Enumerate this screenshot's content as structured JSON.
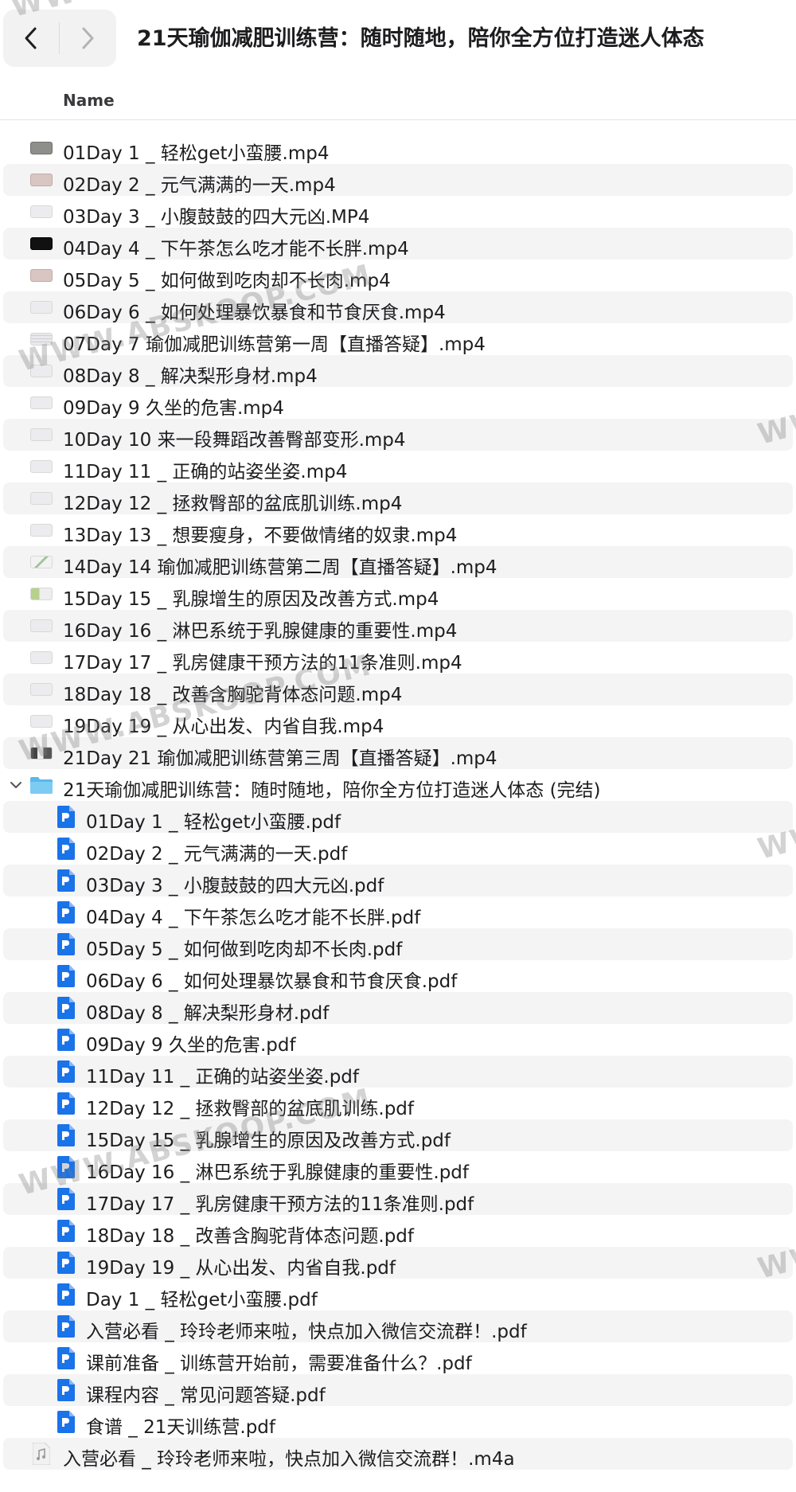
{
  "toolbar": {
    "title": "21天瑜伽减肥训练营：随时随地，陪你全方位打造迷人体态"
  },
  "columns": {
    "name_header": "Name"
  },
  "files": [
    {
      "name": "01Day 1 _ 轻松get小蛮腰.mp4",
      "level": 0,
      "icon": "video-thumbnail-icon",
      "thumb": "gray"
    },
    {
      "name": "02Day 2 _ 元气满满的一天.mp4",
      "level": 0,
      "icon": "video-thumbnail-icon",
      "thumb": "pink"
    },
    {
      "name": "03Day 3 _ 小腹鼓鼓的四大元凶.MP4",
      "level": 0,
      "icon": "video-thumbnail-icon",
      "thumb": "plain"
    },
    {
      "name": "04Day 4 _ 下午茶怎么吃才能不长胖.mp4",
      "level": 0,
      "icon": "video-thumbnail-icon",
      "thumb": "black"
    },
    {
      "name": "05Day 5 _ 如何做到吃肉却不长肉.mp4",
      "level": 0,
      "icon": "video-thumbnail-icon",
      "thumb": "pink"
    },
    {
      "name": "06Day 6 _ 如何处理暴饮暴食和节食厌食.mp4",
      "level": 0,
      "icon": "video-thumbnail-icon",
      "thumb": "plain"
    },
    {
      "name": "07Day 7  瑜伽减肥训练营第一周【直播答疑】.mp4",
      "level": 0,
      "icon": "video-thumbnail-icon",
      "thumb": "grid"
    },
    {
      "name": "08Day 8 _ 解决梨形身材.mp4",
      "level": 0,
      "icon": "video-thumbnail-icon",
      "thumb": "plain"
    },
    {
      "name": "09Day 9 久坐的危害.mp4",
      "level": 0,
      "icon": "video-thumbnail-icon",
      "thumb": "plain"
    },
    {
      "name": "10Day 10 来一段舞蹈改善臀部变形.mp4",
      "level": 0,
      "icon": "video-thumbnail-icon",
      "thumb": "plain"
    },
    {
      "name": "11Day 11 _ 正确的站姿坐姿.mp4",
      "level": 0,
      "icon": "video-thumbnail-icon",
      "thumb": "plain"
    },
    {
      "name": "12Day 12 _ 拯救臀部的盆底肌训练.mp4",
      "level": 0,
      "icon": "video-thumbnail-icon",
      "thumb": "plain"
    },
    {
      "name": "13Day 13 _ 想要瘦身，不要做情绪的奴隶.mp4",
      "level": 0,
      "icon": "video-thumbnail-icon",
      "thumb": "plain"
    },
    {
      "name": "14Day 14  瑜伽减肥训练营第二周【直播答疑】.mp4",
      "level": 0,
      "icon": "video-thumbnail-icon",
      "thumb": "mail"
    },
    {
      "name": "15Day 15 _ 乳腺增生的原因及改善方式.mp4",
      "level": 0,
      "icon": "video-thumbnail-icon",
      "thumb": "green"
    },
    {
      "name": "16Day 16 _ 淋巴系统于乳腺健康的重要性.mp4",
      "level": 0,
      "icon": "video-thumbnail-icon",
      "thumb": "plain"
    },
    {
      "name": "17Day 17 _ 乳房健康干预方法的11条准则.mp4",
      "level": 0,
      "icon": "video-thumbnail-icon",
      "thumb": "plain"
    },
    {
      "name": "18Day 18 _ 改善含胸驼背体态问题.mp4",
      "level": 0,
      "icon": "video-thumbnail-icon",
      "thumb": "plain"
    },
    {
      "name": "19Day 19 _ 从心出发、内省自我.mp4",
      "level": 0,
      "icon": "video-thumbnail-icon",
      "thumb": "plain"
    },
    {
      "name": "21Day 21  瑜伽减肥训练营第三周【直播答疑】.mp4",
      "level": 0,
      "icon": "video-thumbnail-icon",
      "thumb": "dark"
    },
    {
      "name": "21天瑜伽减肥训练营：随时随地，陪你全方位打造迷人体态 (完结)",
      "level": 0,
      "icon": "folder-icon",
      "folder": true
    },
    {
      "name": "01Day 1 _ 轻松get小蛮腰.pdf",
      "level": 1,
      "icon": "pdf-file-icon"
    },
    {
      "name": "02Day 2 _ 元气满满的一天.pdf",
      "level": 1,
      "icon": "pdf-file-icon"
    },
    {
      "name": "03Day 3 _ 小腹鼓鼓的四大元凶.pdf",
      "level": 1,
      "icon": "pdf-file-icon"
    },
    {
      "name": "04Day 4 _ 下午茶怎么吃才能不长胖.pdf",
      "level": 1,
      "icon": "pdf-file-icon"
    },
    {
      "name": "05Day 5 _ 如何做到吃肉却不长肉.pdf",
      "level": 1,
      "icon": "pdf-file-icon"
    },
    {
      "name": "06Day 6 _ 如何处理暴饮暴食和节食厌食.pdf",
      "level": 1,
      "icon": "pdf-file-icon"
    },
    {
      "name": "08Day 8 _ 解决梨形身材.pdf",
      "level": 1,
      "icon": "pdf-file-icon"
    },
    {
      "name": "09Day 9 久坐的危害.pdf",
      "level": 1,
      "icon": "pdf-file-icon"
    },
    {
      "name": "11Day 11 _ 正确的站姿坐姿.pdf",
      "level": 1,
      "icon": "pdf-file-icon"
    },
    {
      "name": "12Day 12 _ 拯救臀部的盆底肌训练.pdf",
      "level": 1,
      "icon": "pdf-file-icon"
    },
    {
      "name": "15Day 15 _ 乳腺增生的原因及改善方式.pdf",
      "level": 1,
      "icon": "pdf-file-icon"
    },
    {
      "name": "16Day 16 _ 淋巴系统于乳腺健康的重要性.pdf",
      "level": 1,
      "icon": "pdf-file-icon"
    },
    {
      "name": "17Day 17 _ 乳房健康干预方法的11条准则.pdf",
      "level": 1,
      "icon": "pdf-file-icon"
    },
    {
      "name": "18Day 18 _ 改善含胸驼背体态问题.pdf",
      "level": 1,
      "icon": "pdf-file-icon"
    },
    {
      "name": "19Day 19 _ 从心出发、内省自我.pdf",
      "level": 1,
      "icon": "pdf-file-icon"
    },
    {
      "name": "Day 1 _ 轻松get小蛮腰.pdf",
      "level": 1,
      "icon": "pdf-file-icon"
    },
    {
      "name": "入营必看 _ 玲玲老师来啦，快点加入微信交流群！.pdf",
      "level": 1,
      "icon": "pdf-file-icon"
    },
    {
      "name": "课前准备 _ 训练营开始前，需要准备什么？.pdf",
      "level": 1,
      "icon": "pdf-file-icon"
    },
    {
      "name": "课程内容 _ 常见问题答疑.pdf",
      "level": 1,
      "icon": "pdf-file-icon"
    },
    {
      "name": "食谱 _ 21天训练营.pdf",
      "level": 1,
      "icon": "pdf-file-icon"
    },
    {
      "name": "入营必看 _ 玲玲老师来啦，快点加入微信交流群！.m4a",
      "level": 0,
      "icon": "audio-file-icon"
    }
  ],
  "watermark": {
    "text": "WWW.ABSKOOP.COM",
    "short": "WW",
    "color": "#787878"
  },
  "colors": {
    "pdf_blue": "#1a73e8",
    "folder_blue": "#5ab8ec",
    "row_alt": "#f4f4f5"
  }
}
